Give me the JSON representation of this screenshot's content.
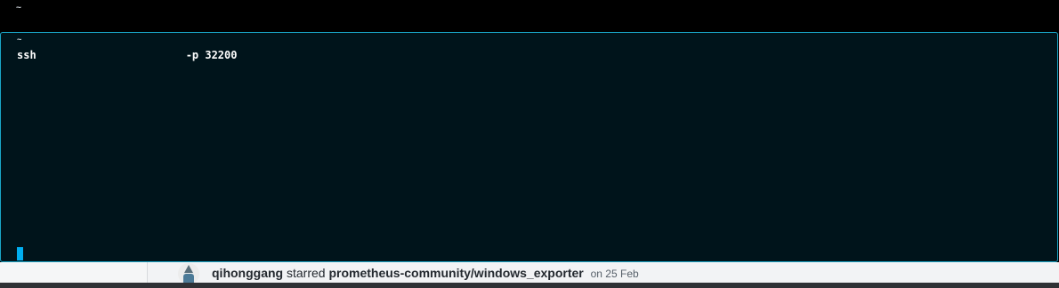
{
  "top_tab": {
    "prompt": "~"
  },
  "terminal": {
    "prompt": "~",
    "command": "ssh",
    "args": "-p 32200",
    "cursor_color": "#00aef0",
    "border_color": "#1aa6c8",
    "background": "#00141b"
  },
  "background_feed": {
    "user": "qihonggang",
    "action": "starred",
    "repo": "prometheus-community/windows_exporter",
    "date": "on 25 Feb",
    "avatar_icon": "octocat-avatar-icon"
  }
}
